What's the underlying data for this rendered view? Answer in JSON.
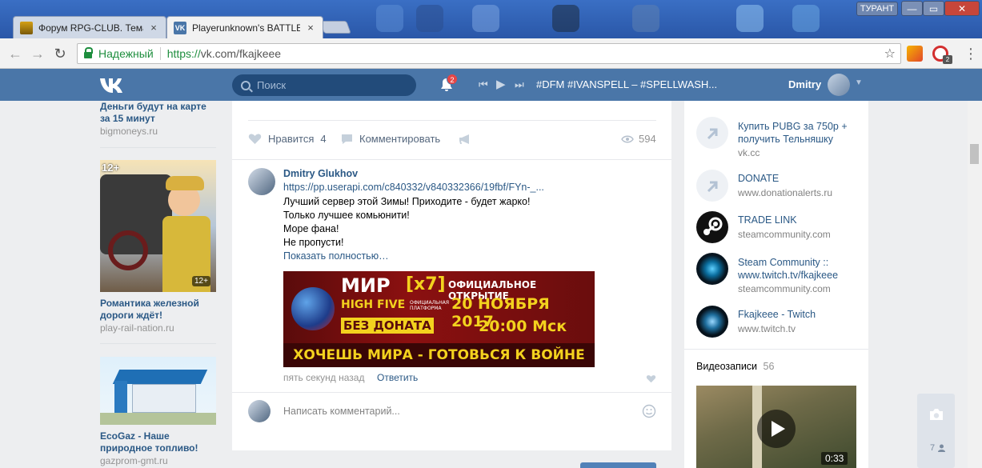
{
  "browser": {
    "tabs": [
      {
        "title": "Форум RPG-CLUB. Тема",
        "close": "×"
      },
      {
        "title": "Playerunknown's BATTLE",
        "close": "×"
      }
    ],
    "user_chip": "ТУРАНТ",
    "window_buttons": [
      "—",
      "▭",
      "✕"
    ],
    "secure_label": "Надежный",
    "url_scheme": "https://",
    "url_rest": "vk.com/fkajkeee",
    "ext_badge": "2"
  },
  "vk": {
    "search_placeholder": "Поиск",
    "notifications_count": "2",
    "now_playing": "#DFM #IVANSPELL – #SPELLWASH...",
    "user_name": "Dmitry"
  },
  "left_ads": [
    {
      "title": "Деньги будут на карте за 15 минут",
      "domain": "bigmoneys.ru"
    },
    {
      "title": "Романтика железной дороги ждёт!",
      "domain": "play-rail-nation.ru",
      "age_badge": "12+",
      "corner_badge": "12+"
    },
    {
      "title": "EcoGaz - Наше природное топливо!",
      "domain": "gazprom-gmt.ru"
    }
  ],
  "post_actions": {
    "like_label": "Нравится",
    "like_count": "4",
    "comment_label": "Комментировать",
    "views": "594"
  },
  "comment": {
    "author": "Dmitry Glukhov",
    "link": "https://pp.userapi.com/c840332/v840332366/19fbf/FYn-_...",
    "lines": [
      "Лучший сервер этой Зимы! Приходите - будет жарко!",
      "Только лучшее комьюнити!",
      "Море фана!",
      "Не пропусти!"
    ],
    "show_more": "Показать полностью…",
    "time": "пять секунд назад",
    "reply": "Ответить"
  },
  "banner": {
    "title": "МИР",
    "tag": "[x7]",
    "subtitle": "HIGH FIVE",
    "platform": "ОФИЦИАЛЬНАЯ ПЛАТФОРМА",
    "opening": "ОФИЦИАЛЬНОЕ ОТКРЫТИЕ",
    "date": "20 НОЯБРЯ 2017",
    "time": "20:00 Мск",
    "no_donate": "БЕЗ ДОНАТА",
    "slogan": "ХОЧЕШЬ МИРА - ГОТОВЬСЯ К ВОЙНЕ"
  },
  "write_comment_placeholder": "Написать комментарий...",
  "links": [
    {
      "title": "Купить PUBG за 750р + получить Тельняшку",
      "domain": "vk.cc",
      "icon": "link-arrow-icon"
    },
    {
      "title": "DONATE",
      "domain": "www.donationalerts.ru",
      "icon": "link-arrow-icon"
    },
    {
      "title": "TRADE LINK",
      "domain": "steamcommunity.com",
      "icon": "steam-icon"
    },
    {
      "title": "Steam Community :: www.twitch.tv/fkajkeee",
      "domain": "steamcommunity.com",
      "icon": "eye-icon"
    },
    {
      "title": "Fkajkeee - Twitch",
      "domain": "www.twitch.tv",
      "icon": "eye-icon"
    }
  ],
  "videos": {
    "label": "Видеозаписи",
    "count": "56",
    "duration": "0:33"
  },
  "photo_widget_count": "7",
  "colors": {
    "vk_blue": "#4a76a8",
    "link_blue": "#2a5885",
    "background": "#edeef0",
    "banner_red": "#8b1010",
    "banner_yellow": "#f3d21e"
  }
}
